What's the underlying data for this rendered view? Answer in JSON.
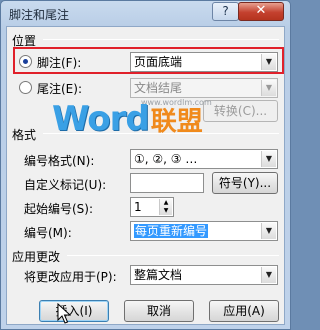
{
  "window": {
    "title": "脚注和尾注",
    "help_label": "?",
    "close_label": "✕"
  },
  "position": {
    "section_title": "位置",
    "footnote": {
      "label": "脚注(F):",
      "value": "页面底端",
      "selected": true
    },
    "endnote": {
      "label": "尾注(E):",
      "value": "文档结尾",
      "selected": false
    },
    "convert_button": "转换(C)..."
  },
  "format": {
    "section_title": "格式",
    "number_format_label": "编号格式(N):",
    "number_format_value": "①, ②, ③ …",
    "custom_mark_label": "自定义标记(U):",
    "custom_mark_value": "",
    "symbol_button": "符号(Y)...",
    "start_at_label": "起始编号(S):",
    "start_at_value": "1",
    "numbering_label": "编号(M):",
    "numbering_value": "每页重新编号"
  },
  "apply": {
    "section_title": "应用更改",
    "apply_to_label": "将更改应用于(P):",
    "apply_to_value": "整篇文档"
  },
  "buttons": {
    "insert": "插入(I)",
    "cancel": "取消",
    "apply": "应用(A)"
  },
  "watermark": {
    "url": "www.wordlm.com",
    "brand_word": "Word",
    "brand_cn": "联盟"
  },
  "colors": {
    "highlight_box": "#e0202a",
    "selection": "#3399ff",
    "brand_blue": "#3aa0e5",
    "brand_orange": "#f08a1c"
  }
}
